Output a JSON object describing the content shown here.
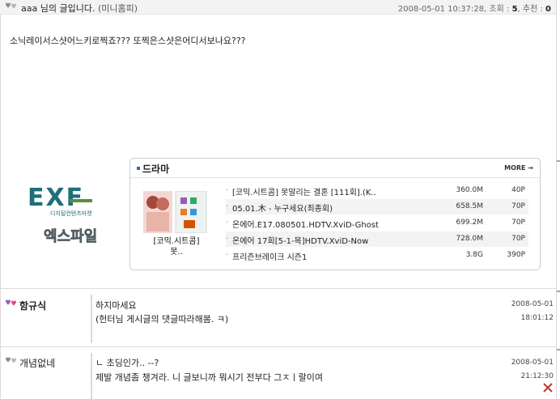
{
  "post": {
    "author": "aaa",
    "author_suffix": " 님의 글입니다. ",
    "minihompy": "(미니홈피)",
    "datetime": "2008-05-01 10:37:28",
    "views_label": "조회 : ",
    "views": "5",
    "recommend_label": "추천 : ",
    "recommend": "0",
    "body": "소닉레이서스샷어느키로찍죠??? 또찍은스샷은어디서보나요???"
  },
  "ad": {
    "logo_text_en": "EXF",
    "logo_sub": "디지털컨텐츠마켓",
    "logo_kr": "엑스파일",
    "box_title": "드라마",
    "more": "MORE",
    "thumb_caption_1": "[코믹.시트콤]",
    "thumb_caption_2": "못..",
    "items": [
      {
        "title": "[코믹.시트콤] 못말리는 결혼 [111회].(K..",
        "size": "360.0M",
        "points": "40P"
      },
      {
        "title": "05.01.木 - 누구세요(최종회)",
        "size": "658.5M",
        "points": "70P"
      },
      {
        "title": "온에어.E17.080501.HDTV.XviD-Ghost",
        "size": "699.2M",
        "points": "70P"
      },
      {
        "title": "온에어 17회[5-1-목]HDTV.XviD-Now",
        "size": "728.0M",
        "points": "70P"
      },
      {
        "title": "프리즌브레이크 시즌1",
        "size": "3.8G",
        "points": "390P"
      }
    ]
  },
  "comments": [
    {
      "name": "함규식",
      "lines": [
        "하지마세요",
        "(헌터님 게시글의 댓글따라해봄. ㅋ)"
      ],
      "date": "2008-05-01",
      "time": "18:01:12"
    },
    {
      "name": "개념없네",
      "lines": [
        "ㄴ 초딩인가.. --?",
        "제발 개념좀 챙겨라. 니 글보니까 뭐시기 전부다 그ㅈㅣ랄이여"
      ],
      "date": "2008-05-01",
      "time": "21:12:30"
    }
  ],
  "colors": {
    "accent_blue": "#2f6fb0",
    "close_red": "#c0392b",
    "exf_teal": "#1f6f7a"
  }
}
